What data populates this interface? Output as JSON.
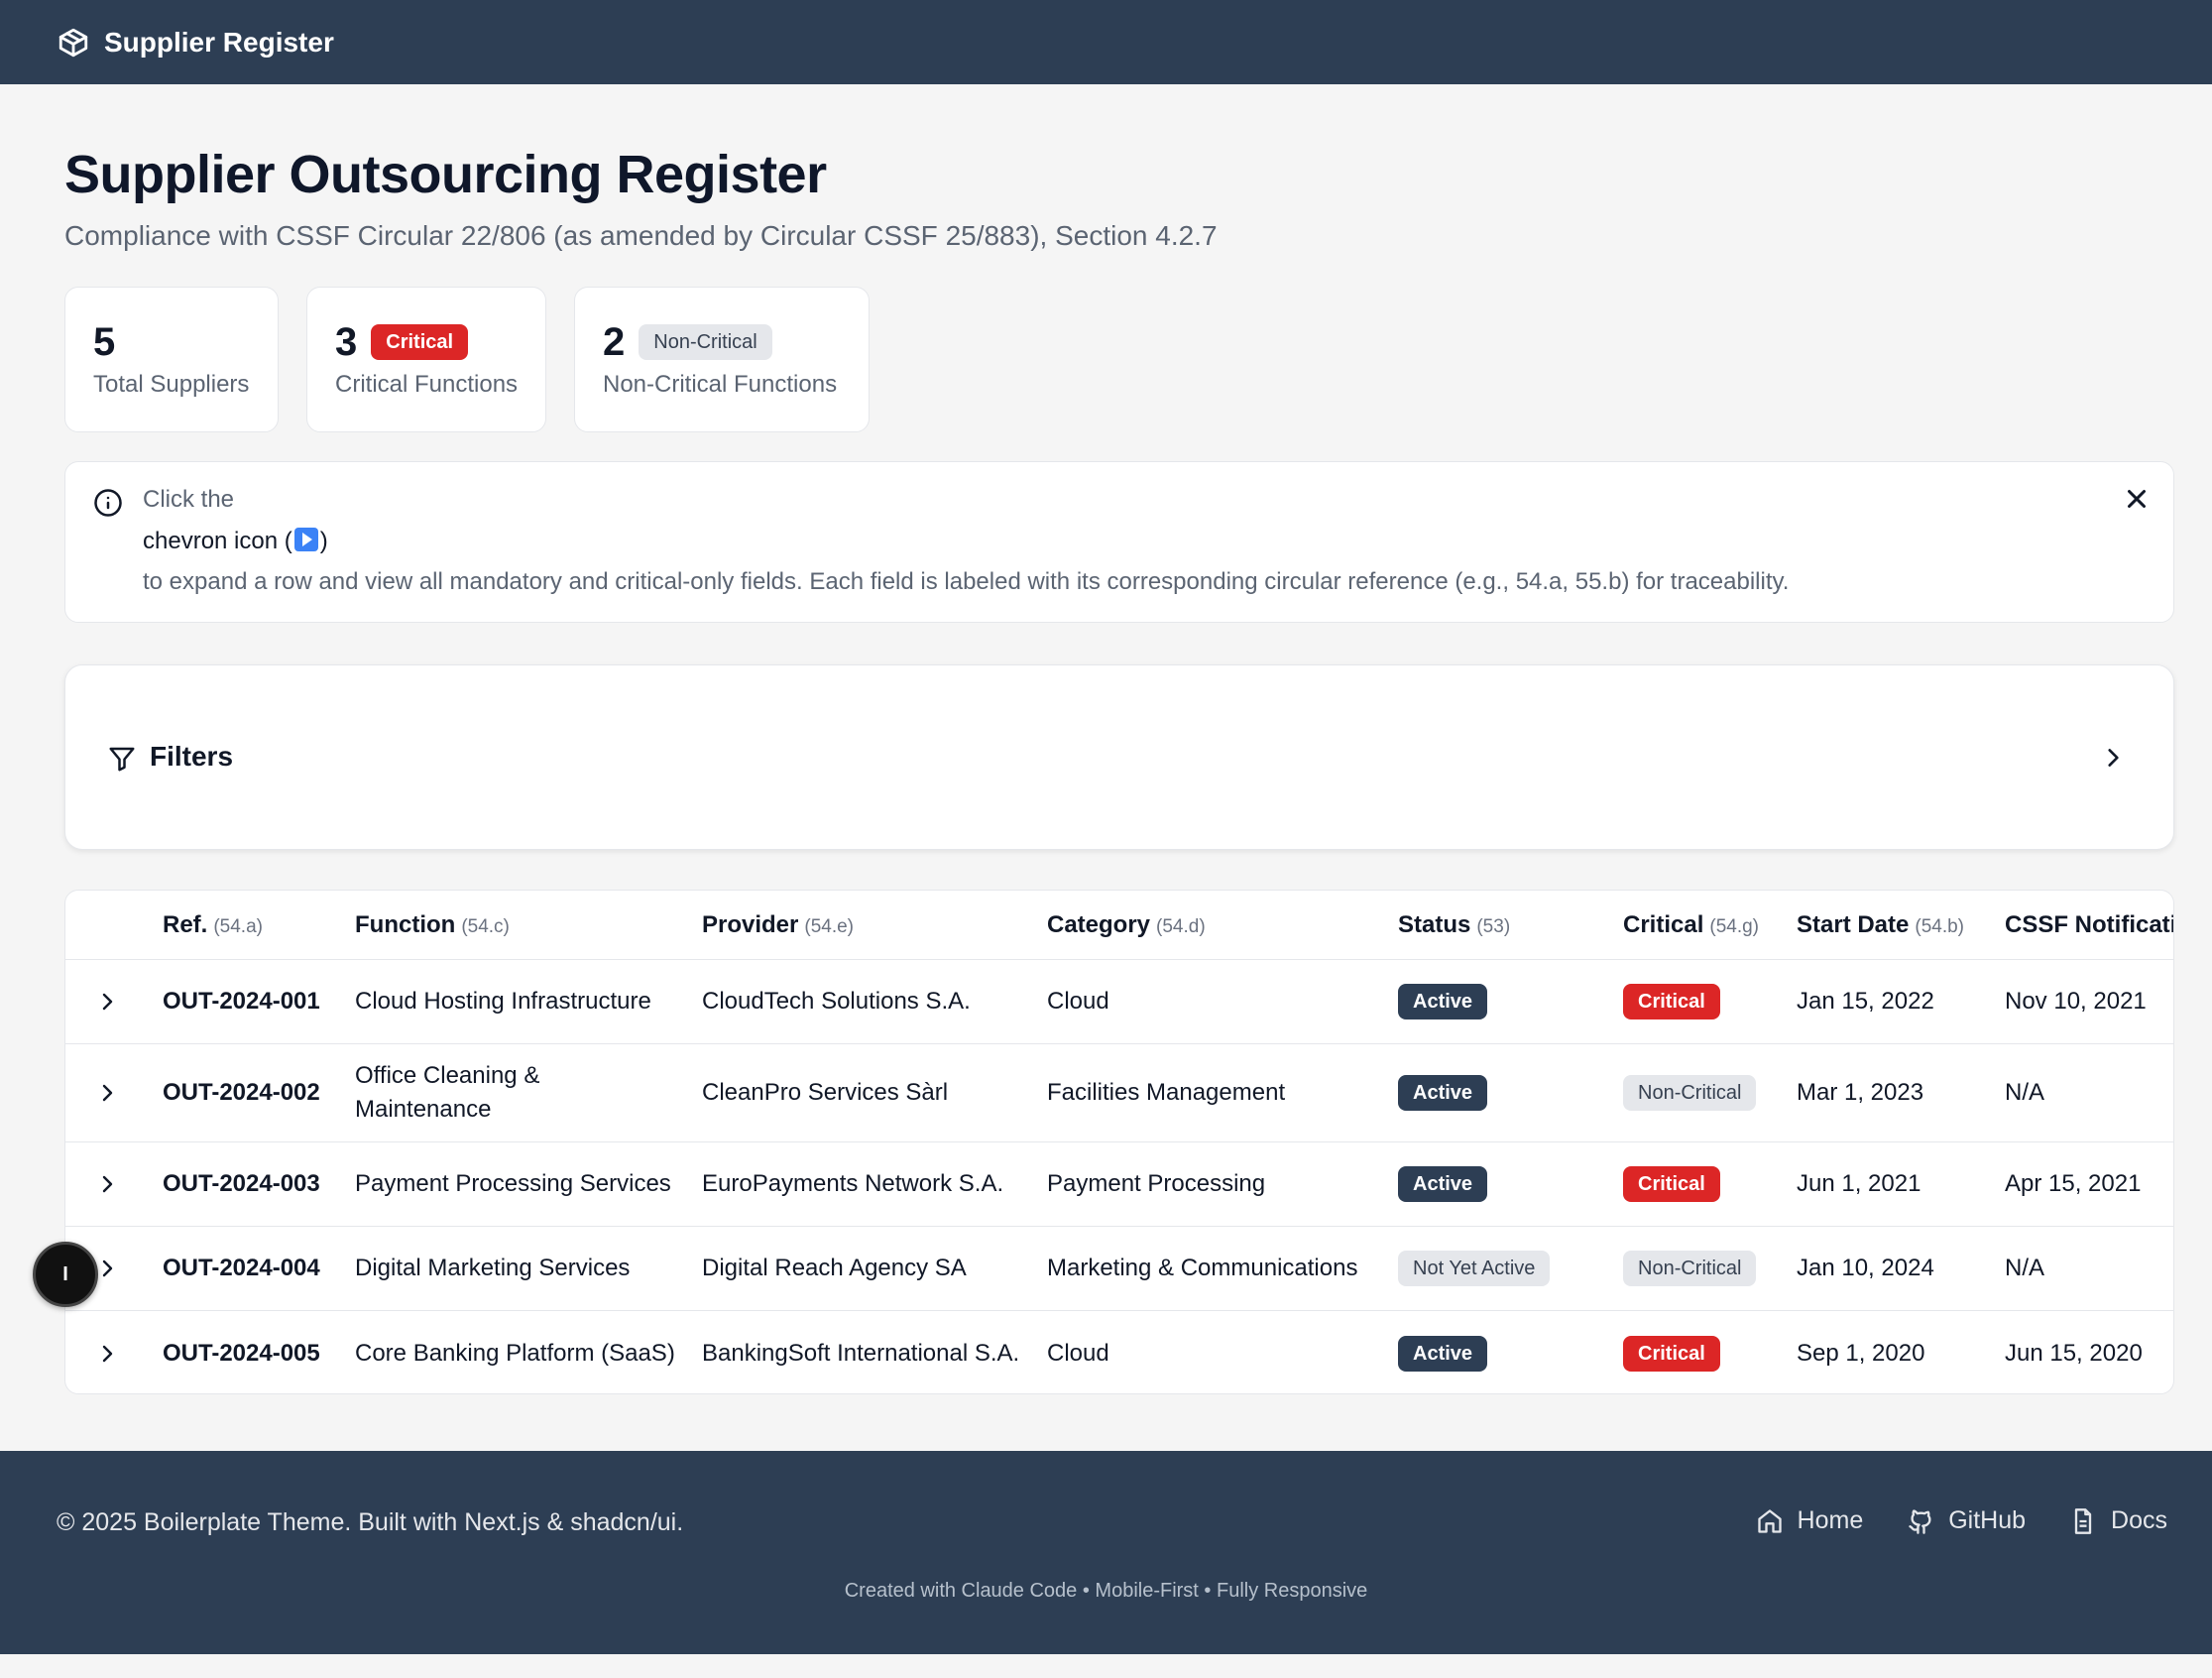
{
  "app": {
    "brand": "Supplier Register"
  },
  "page": {
    "title": "Supplier Outsourcing Register",
    "subtitle": "Compliance with CSSF Circular 22/806 (as amended by Circular CSSF 25/883), Section 4.2.7"
  },
  "stats": [
    {
      "num": "5",
      "label": "Total Suppliers",
      "badge": ""
    },
    {
      "num": "3",
      "label": "Critical Functions",
      "badge": "Critical"
    },
    {
      "num": "2",
      "label": "Non-Critical Functions",
      "badge": "Non-Critical"
    }
  ],
  "info": {
    "line1": "Click the",
    "line2_pre": "chevron icon (",
    "line2_post": ")",
    "line3": "to expand a row and view all mandatory and critical-only fields. Each field is labeled with its corresponding circular reference (e.g., 54.a, 55.b) for traceability."
  },
  "filters": {
    "label": "Filters"
  },
  "table": {
    "columns": [
      {
        "label": "Ref.",
        "ref": "(54.a)"
      },
      {
        "label": "Function",
        "ref": "(54.c)"
      },
      {
        "label": "Provider",
        "ref": "(54.e)"
      },
      {
        "label": "Category",
        "ref": "(54.d)"
      },
      {
        "label": "Status",
        "ref": "(53)"
      },
      {
        "label": "Critical",
        "ref": "(54.g)"
      },
      {
        "label": "Start Date",
        "ref": "(54.b)"
      },
      {
        "label": "CSSF Notificatio",
        "ref": ""
      }
    ],
    "rows": [
      {
        "ref": "OUT-2024-001",
        "function": "Cloud Hosting Infrastructure",
        "function2": "",
        "provider": "CloudTech Solutions S.A.",
        "category": "Cloud",
        "status": "Active",
        "critical": "Critical",
        "start": "Jan 15, 2022",
        "notif": "Nov 10, 2021"
      },
      {
        "ref": "OUT-2024-002",
        "function": "Office Cleaning &",
        "function2": "Maintenance",
        "provider": "CleanPro Services Sàrl",
        "category": "Facilities Management",
        "status": "Active",
        "critical": "Non-Critical",
        "start": "Mar 1, 2023",
        "notif": "N/A"
      },
      {
        "ref": "OUT-2024-003",
        "function": "Payment Processing Services",
        "function2": "",
        "provider": "EuroPayments Network S.A.",
        "category": "Payment Processing",
        "status": "Active",
        "critical": "Critical",
        "start": "Jun 1, 2021",
        "notif": "Apr 15, 2021"
      },
      {
        "ref": "OUT-2024-004",
        "function": "Digital Marketing Services",
        "function2": "",
        "provider": "Digital Reach Agency SA",
        "category": "Marketing & Communications",
        "status": "Not Yet Active",
        "critical": "Non-Critical",
        "start": "Jan 10, 2024",
        "notif": "N/A"
      },
      {
        "ref": "OUT-2024-005",
        "function": "Core Banking Platform (SaaS)",
        "function2": "",
        "provider": "BankingSoft International S.A.",
        "category": "Cloud",
        "status": "Active",
        "critical": "Critical",
        "start": "Sep 1, 2020",
        "notif": "Jun 15, 2020"
      }
    ]
  },
  "fab": {
    "label": "I"
  },
  "footer": {
    "copy": "© 2025 Boilerplate Theme. Built with Next.js & shadcn/ui.",
    "links": {
      "home": "Home",
      "github": "GitHub",
      "docs": "Docs"
    },
    "small": "Created with Claude Code • Mobile-First • Fully Responsive"
  },
  "colors": {
    "navy": "#2d3e54",
    "critical": "#dc2626",
    "muted": "#e5e7eb"
  }
}
